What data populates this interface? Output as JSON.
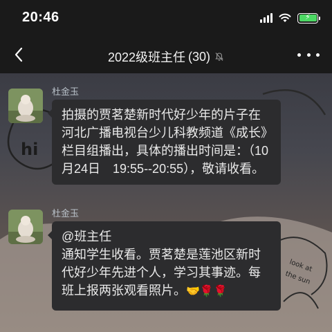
{
  "status": {
    "time": "20:46"
  },
  "nav": {
    "title": "2022级班主任",
    "count": "(30)"
  },
  "messages": [
    {
      "sender": "杜金玉",
      "text": "拍摄的贾茗楚新时代好少年的片子在河北广播电视台少儿科教频道《成长》栏目组播出，具体的播出时间是：（10月24日　19:55--20:55），敬请收看。"
    },
    {
      "sender": "杜金玉",
      "mention": "@班主任",
      "text": "通知学生收看。贾茗楚是莲池区新时代好少年先进个人，学习其事迹。每班上报两张观看照片。",
      "emojis": "🤝🌹🌹"
    }
  ],
  "colors": {
    "bubble": "#2c2c2e",
    "bar": "#1a1a1a",
    "battery": "#4cd964"
  },
  "icons": [
    "back-arrow-icon",
    "mute-bell-icon",
    "more-dots-icon",
    "signal-icon",
    "wifi-icon",
    "battery-icon"
  ]
}
